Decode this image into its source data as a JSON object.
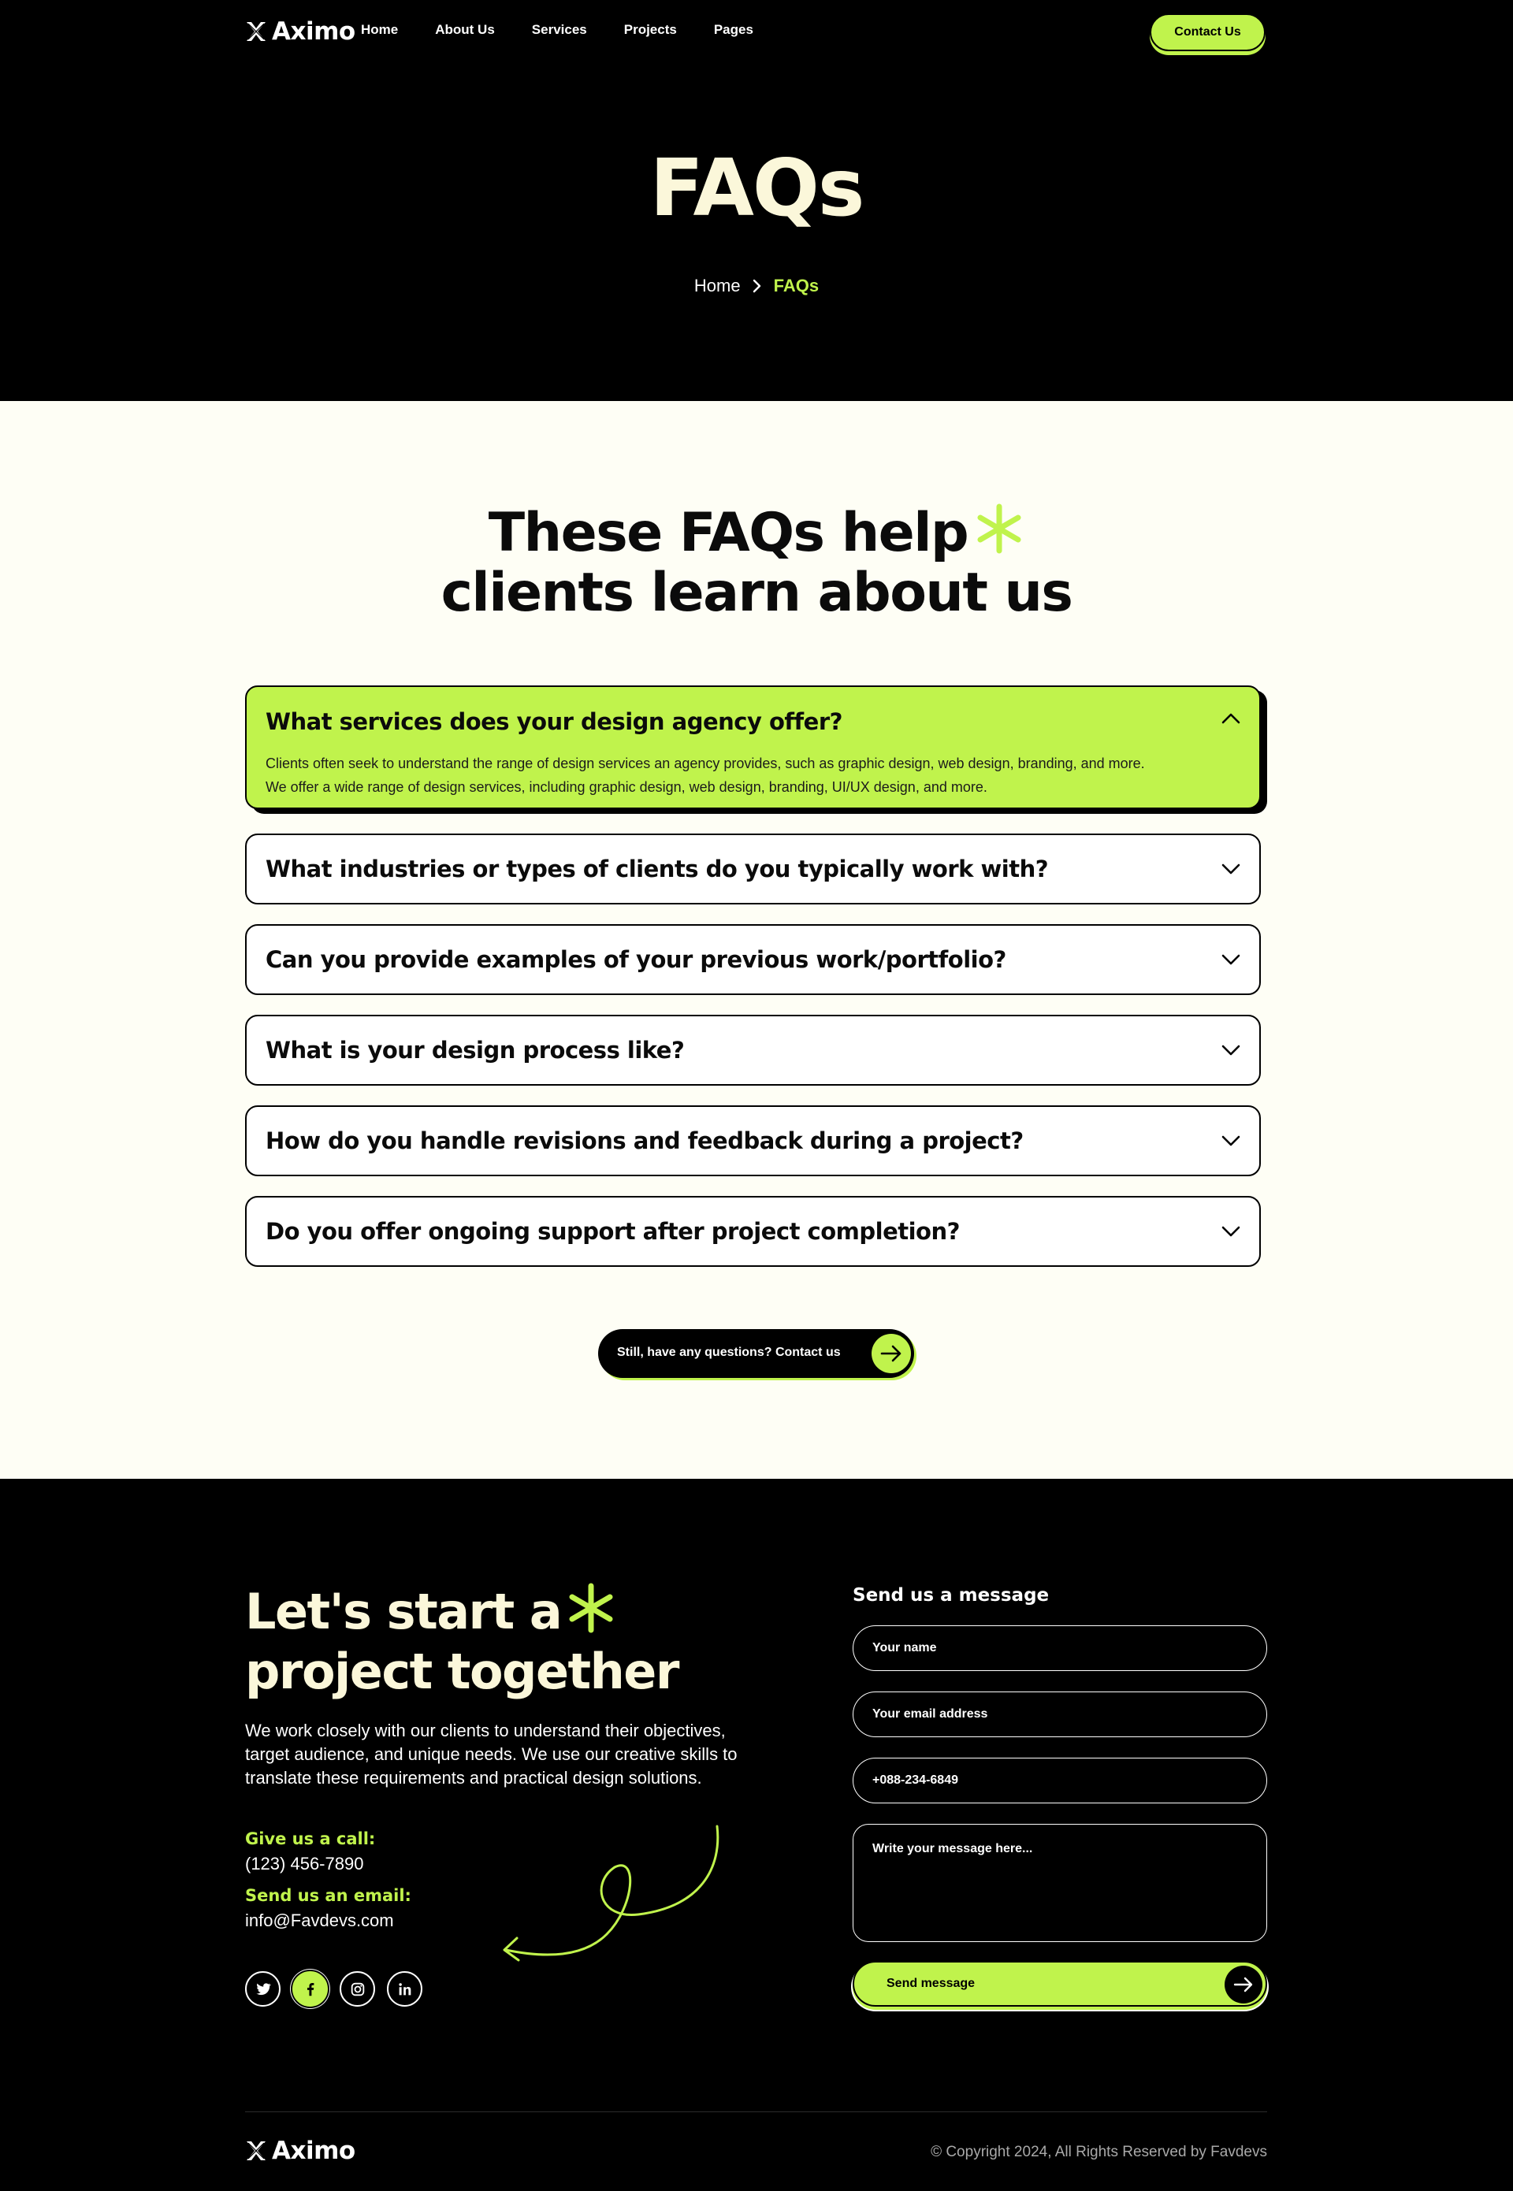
{
  "brand": {
    "name": "Aximo"
  },
  "nav": {
    "items": [
      "Home",
      "About Us",
      "Services",
      "Projects",
      "Pages"
    ],
    "contact_label": "Contact Us"
  },
  "hero": {
    "title": "FAQs",
    "breadcrumb": {
      "home": "Home",
      "current": "FAQs"
    }
  },
  "faq": {
    "heading_line1": "These FAQs help",
    "heading_line2": "clients learn about us",
    "items": [
      {
        "question": "What services does your design agency offer?",
        "answer": "Clients often seek to understand the range of design services an agency provides, such as graphic design, web design, branding, and more. We offer a wide range of design services, including graphic design, web design, branding, UI/UX design, and more.",
        "expanded": true
      },
      {
        "question": "What industries or types of clients do you typically work with?",
        "expanded": false
      },
      {
        "question": "Can you provide examples of your previous work/portfolio?",
        "expanded": false
      },
      {
        "question": "What is your design process like?",
        "expanded": false
      },
      {
        "question": "How do you handle revisions and feedback during a project?",
        "expanded": false
      },
      {
        "question": "Do you offer ongoing support after project completion?",
        "expanded": false
      }
    ],
    "cta_label": "Still, have any questions? Contact us"
  },
  "cta": {
    "title_line1": "Let's start a",
    "title_line2": "project together",
    "description": "We work closely with our clients to understand their objectives, target audience, and unique needs. We use our creative skills to translate these requirements and practical design solutions.",
    "call_label": "Give us a call:",
    "phone": "(123) 456-7890",
    "email_label": "Send us an email:",
    "email": "info@Favdevs.com",
    "socials": [
      "twitter-icon",
      "facebook-icon",
      "instagram-icon",
      "linkedin-icon"
    ]
  },
  "form": {
    "title": "Send us a message",
    "name_placeholder": "Your name",
    "email_placeholder": "Your email address",
    "phone_placeholder": "+088-234-6849",
    "message_placeholder": "Write your message here...",
    "submit_label": "Send message"
  },
  "footer": {
    "copyright": "© Copyright 2024, All Rights Reserved by Favdevs"
  },
  "colors": {
    "accent": "#c0f34c",
    "dark": "#000000",
    "cream": "#fbf7da",
    "section_bg": "#fefef5"
  }
}
